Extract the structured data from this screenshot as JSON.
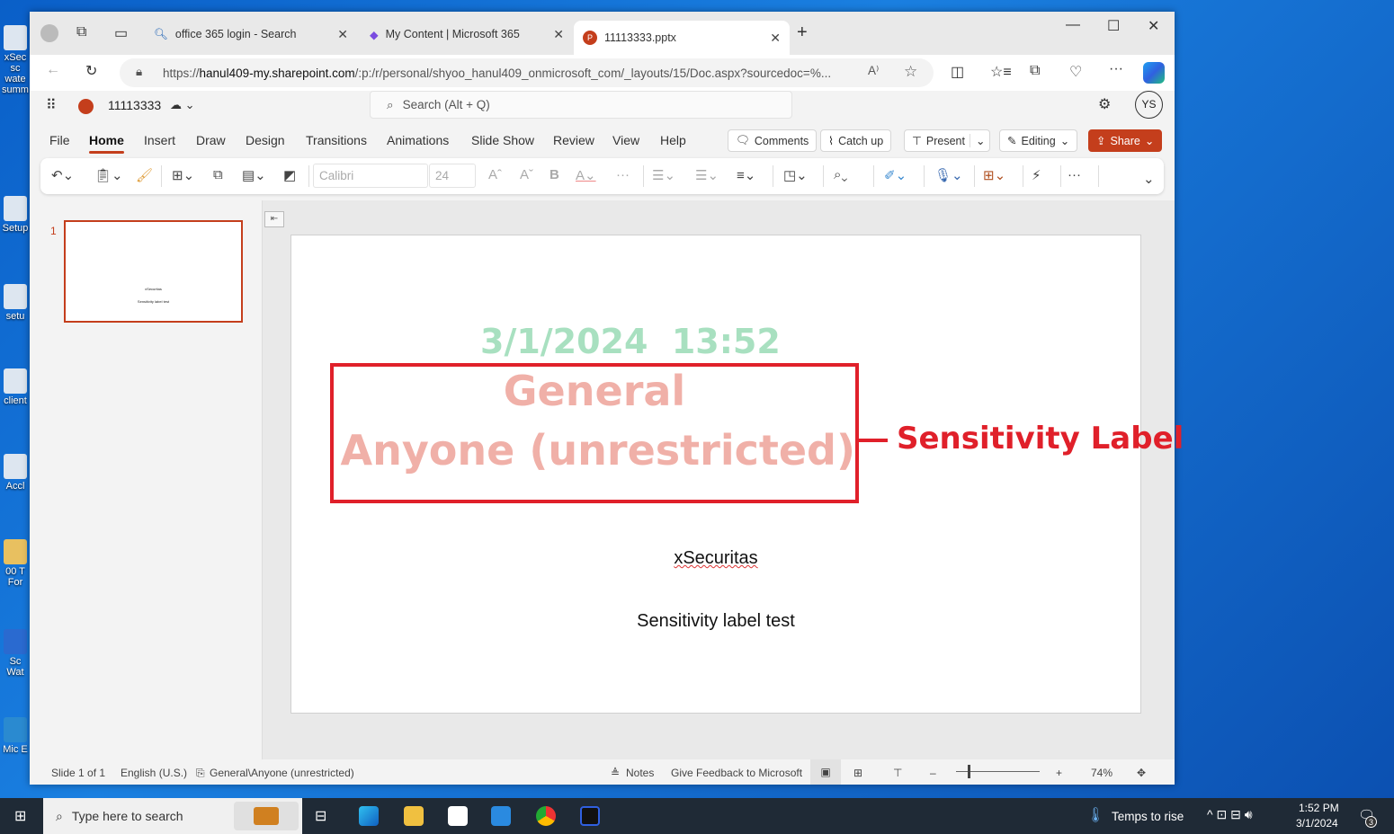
{
  "desktop": {
    "icons": [
      "xSec sc wate summ",
      "Setup",
      "setu",
      "client",
      "Accl",
      "00 T For",
      "Sc Wat",
      "Mic E"
    ]
  },
  "browser": {
    "tabs": [
      {
        "label": "office 365 login - Search",
        "icon": "search-icon"
      },
      {
        "label": "My Content | Microsoft 365",
        "icon": "m365-icon"
      },
      {
        "label": "11113333.pptx",
        "icon": "powerpoint-icon",
        "active": true
      }
    ],
    "url_prefix": "https://",
    "url_host": "hanul409-my.sharepoint.com",
    "url_path": "/:p:/r/personal/shyoo_hanul409_onmicrosoft_com/_layouts/15/Doc.aspx?sourcedoc=%..."
  },
  "app": {
    "doc_title": "11113333",
    "search_placeholder": "Search (Alt + Q)",
    "avatar": "YS",
    "menus": [
      "File",
      "Home",
      "Insert",
      "Draw",
      "Design",
      "Transitions",
      "Animations",
      "Slide Show",
      "Review",
      "View",
      "Help"
    ],
    "active_menu": "Home",
    "buttons": {
      "comments": "Comments",
      "catchup": "Catch up",
      "present": "Present",
      "editing": "Editing",
      "share": "Share"
    },
    "ribbon": {
      "font": "Calibri",
      "size": "24"
    },
    "accent": "#c43e1c"
  },
  "slide_panel": {
    "number": "1"
  },
  "slide": {
    "datetime": "3/1/2024  13:52",
    "label_line1": "General",
    "label_line2": "Anyone (unrestricted)",
    "annotation": "Sensitivity Label",
    "subtitle1": "xSecuritas",
    "subtitle2": "Sensitivity label test",
    "colors": {
      "datetime": "#a8e0c0",
      "label": "#f0b0a8",
      "annotation": "#e0202a"
    }
  },
  "status": {
    "slide": "Slide 1 of 1",
    "language": "English (U.S.)",
    "sensitivity": "General\\Anyone (unrestricted)",
    "notes": "Notes",
    "feedback": "Give Feedback to Microsoft",
    "zoom": "74%",
    "zoom_value": 74
  },
  "taskbar": {
    "search_placeholder": "Type here to search",
    "weather": "Temps to rise",
    "time": "1:52 PM",
    "date": "3/1/2024",
    "notifications": "3"
  }
}
